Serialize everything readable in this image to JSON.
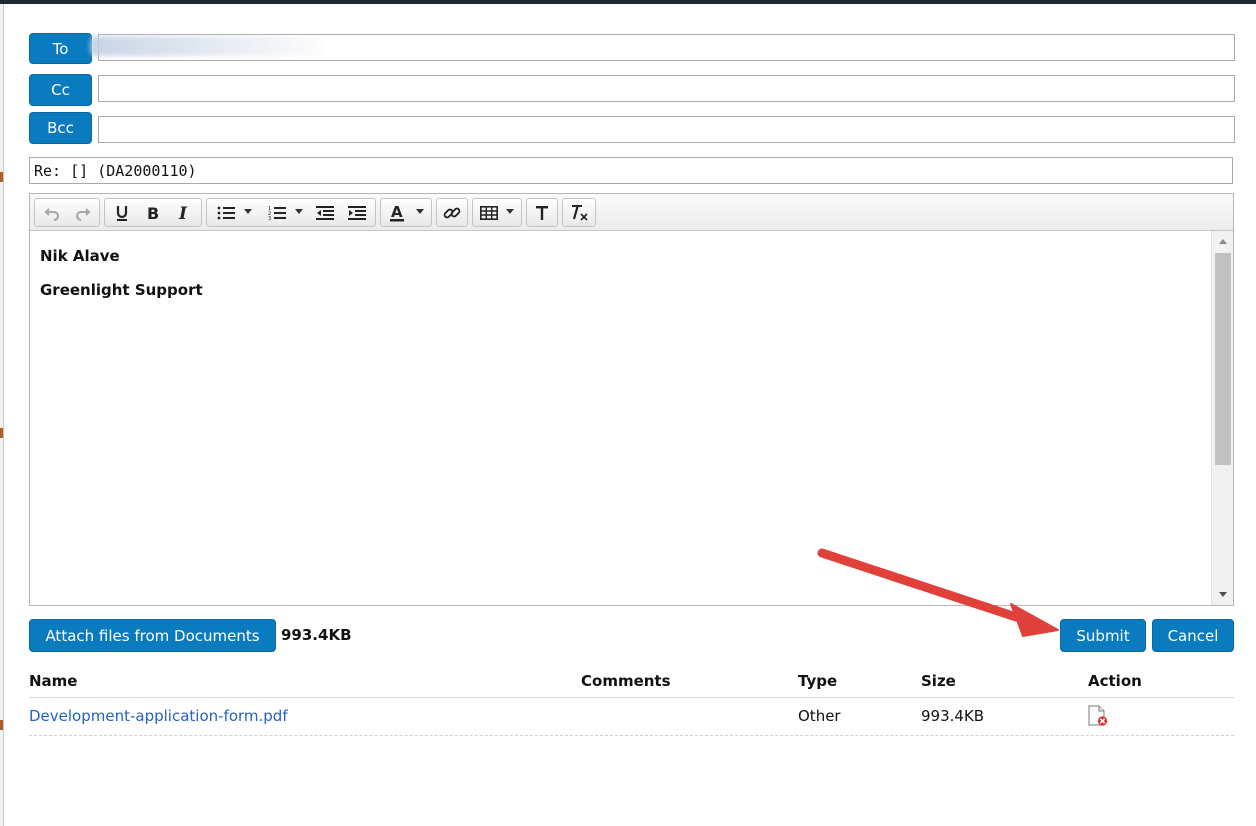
{
  "recipients": {
    "to_label": "To",
    "cc_label": "Cc",
    "bcc_label": "Bcc",
    "to_value": "",
    "cc_value": "",
    "bcc_value": ""
  },
  "subject": "Re: [] (DA2000110)",
  "toolbar": {
    "icons": [
      "undo-icon",
      "redo-icon",
      "underline-icon",
      "bold-icon",
      "italic-icon",
      "bullet-list-icon",
      "numbered-list-icon",
      "outdent-icon",
      "indent-icon",
      "text-color-icon",
      "link-icon",
      "table-icon",
      "format-text-icon",
      "clear-formatting-icon"
    ]
  },
  "editor": {
    "lines": [
      "Nik Alave",
      "Greenlight Support"
    ]
  },
  "actions": {
    "attach_label": "Attach files from Documents",
    "total_size": "993.4KB",
    "submit_label": "Submit",
    "cancel_label": "Cancel"
  },
  "attachments": {
    "headers": {
      "name": "Name",
      "comments": "Comments",
      "type": "Type",
      "size": "Size",
      "action": "Action"
    },
    "rows": [
      {
        "name": "Development-application-form.pdf",
        "comments": "",
        "type": "Other",
        "size": "993.4KB"
      }
    ]
  },
  "colors": {
    "button_blue": "#0a7bbf",
    "link_blue": "#2561c4",
    "arrow_red": "#e0413a"
  }
}
